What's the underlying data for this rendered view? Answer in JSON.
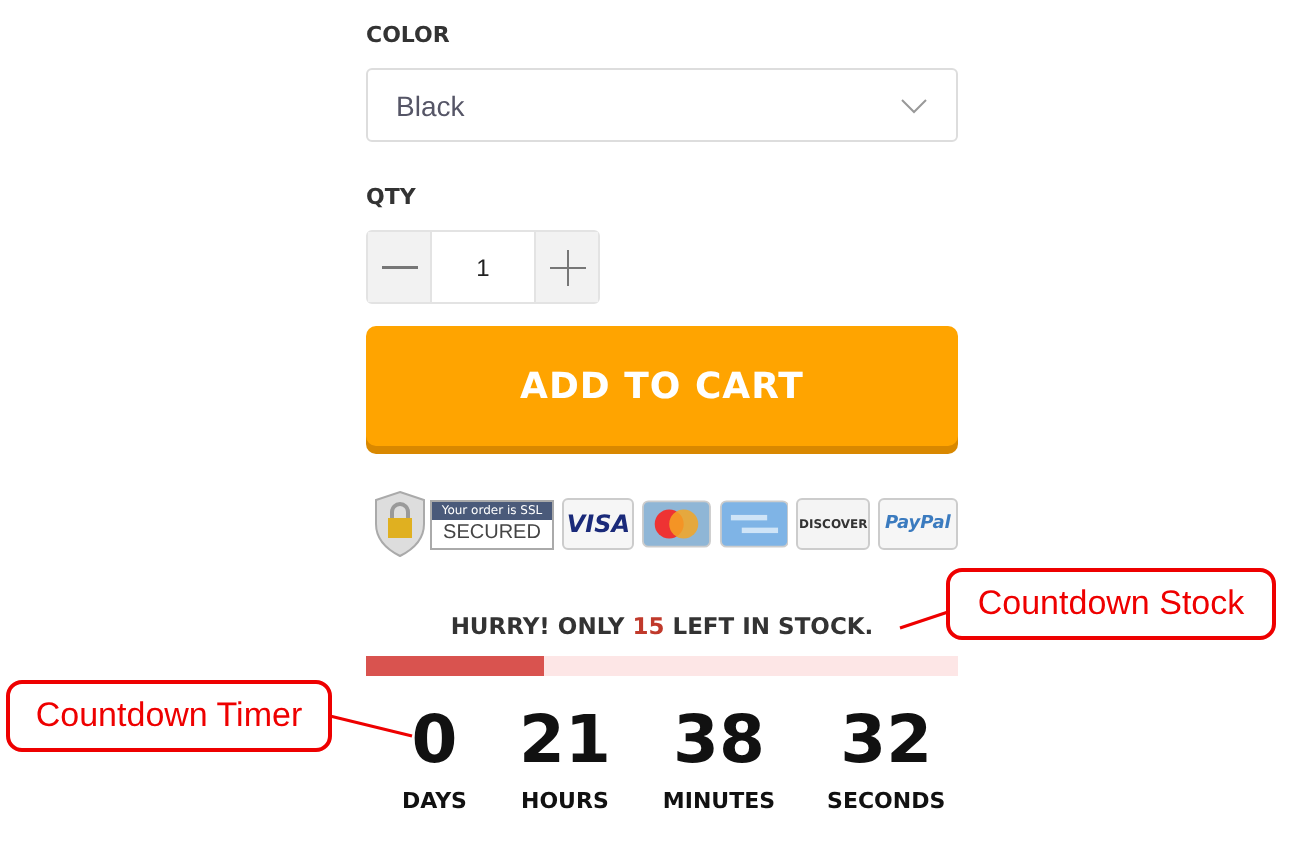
{
  "color_field": {
    "label": "COLOR",
    "value": "Black"
  },
  "qty_field": {
    "label": "QTY",
    "value": "1"
  },
  "add_to_cart": "ADD TO CART",
  "badges": {
    "ssl_top": "Your order is SSL",
    "ssl_bottom": "SECURED",
    "visa": "VISA",
    "discover": "DISCOVER",
    "paypal": "PayPal"
  },
  "stock": {
    "before": "HURRY! ONLY",
    "count": "15",
    "after": "LEFT IN STOCK.",
    "level": 0.3
  },
  "timer": [
    {
      "value": "0",
      "unit": "DAYS"
    },
    {
      "value": "21",
      "unit": "HOURS"
    },
    {
      "value": "38",
      "unit": "MINUTES"
    },
    {
      "value": "32",
      "unit": "SECONDS"
    }
  ],
  "callouts": [
    {
      "text": "Countdown Stock"
    },
    {
      "text": "Countdown Timer"
    }
  ]
}
